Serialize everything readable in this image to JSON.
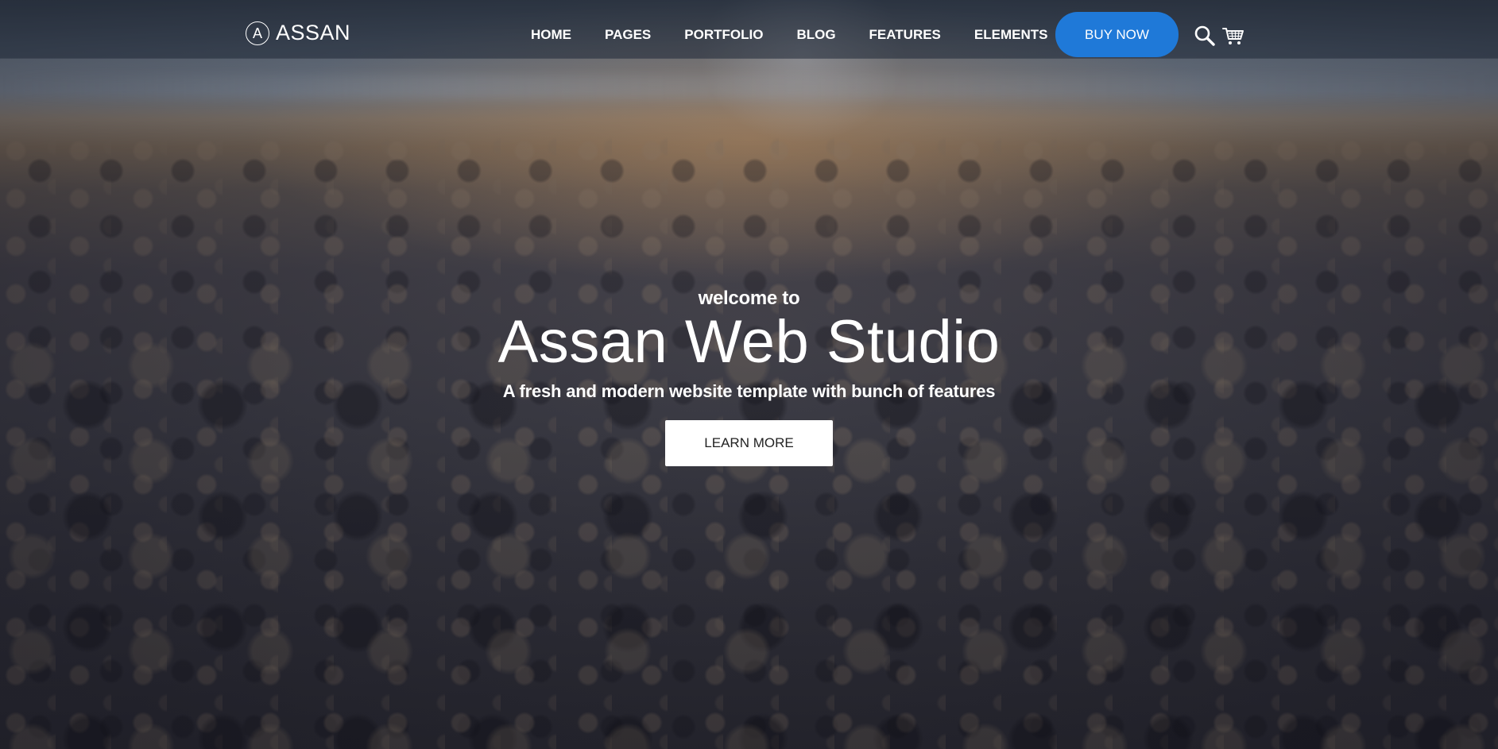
{
  "navbar": {
    "logo": {
      "mark": "A",
      "text": "ASSAN"
    },
    "menu": [
      {
        "label": "HOME"
      },
      {
        "label": "PAGES"
      },
      {
        "label": "PORTFOLIO"
      },
      {
        "label": "BLOG"
      },
      {
        "label": "FEATURES"
      },
      {
        "label": "ELEMENTS"
      }
    ],
    "buy_button": "BUY NOW",
    "icons": {
      "search": "search-icon",
      "cart": "cart-icon"
    }
  },
  "hero": {
    "eyebrow": "welcome to",
    "title": "Assan Web Studio",
    "subtitle": "A fresh and modern website template with bunch of features",
    "cta": "LEARN MORE"
  },
  "colors": {
    "accent": "#1f79d8",
    "navbar_bg": "#1e2634",
    "text": "#ffffff"
  }
}
